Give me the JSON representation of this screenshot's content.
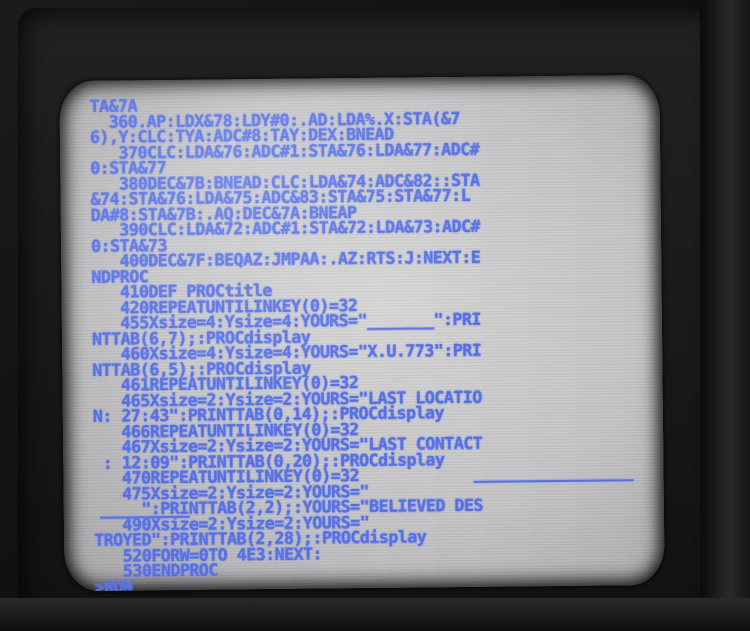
{
  "screen": {
    "lines": [
      "TA&7A",
      "  360.AP:LDX&78:LDY#0:.AD:LDA%.X:STA(&7",
      "6),Y:CLC:TYA:ADC#8:TAY:DEX:BNEAD",
      "   370CLC:LDA&76:ADC#1:STA&76:LDA&77:ADC#",
      "0:STA&77",
      "   380DEC&7B:BNEAD:CLC:LDA&74:ADC&82::STA",
      "&74:STA&76:LDA&75:ADC&83:STA&75:STA&77:L",
      "DA#8:STA&7B:.AQ:DEC&7A:BNEAP",
      "   390CLC:LDA&72:ADC#1:STA&72:LDA&73:ADC#",
      "0:STA&73",
      "   400DEC&7F:BEQAZ:JMPAA:.AZ:RTS:J:NEXT:E",
      "NDPROC",
      "   410DEF PROCtitle",
      "   420REPEATUNTILINKEY(0)=32",
      "   455Xsize=4:Ysize=4:YOURS=\"_______\":PRI",
      "NTTAB(6,7);:PROCdisplay",
      "   460Xsize=4:Ysize=4:YOURS=\"X.U.773\":PRI",
      "NTTAB(6,5);:PROCdisplay",
      "   461REPEATUNTILINKEY(0)=32",
      "   465Xsize=2:Ysize=2:YOURS=\"LAST LOCATIO",
      "N: 27:43\":PRINTTAB(0,14);:PROCdisplay",
      "   466REPEATUNTILINKEY(0)=32",
      "   467Xsize=2:Ysize=2:YOURS=\"LAST CONTACT",
      " : 12:09\":PRINTTAB(0,20);:PROCdisplay",
      "   470REPEATUNTILINKEY(0)=32",
      "   475Xsize=2:Ysize=2:YOURS=\"",
      "     \":PRINTTAB(2,2);:YOURS=\"BELIEVED DES",
      "   490Xsize=2:Ysize=2:YOURS=\"",
      "TROYED\":PRINTTAB(2,28);:PROCdisplay",
      "   520FORW=0TO 4E3:NEXT:",
      "   530ENDPROC",
      ">RUN"
    ]
  }
}
